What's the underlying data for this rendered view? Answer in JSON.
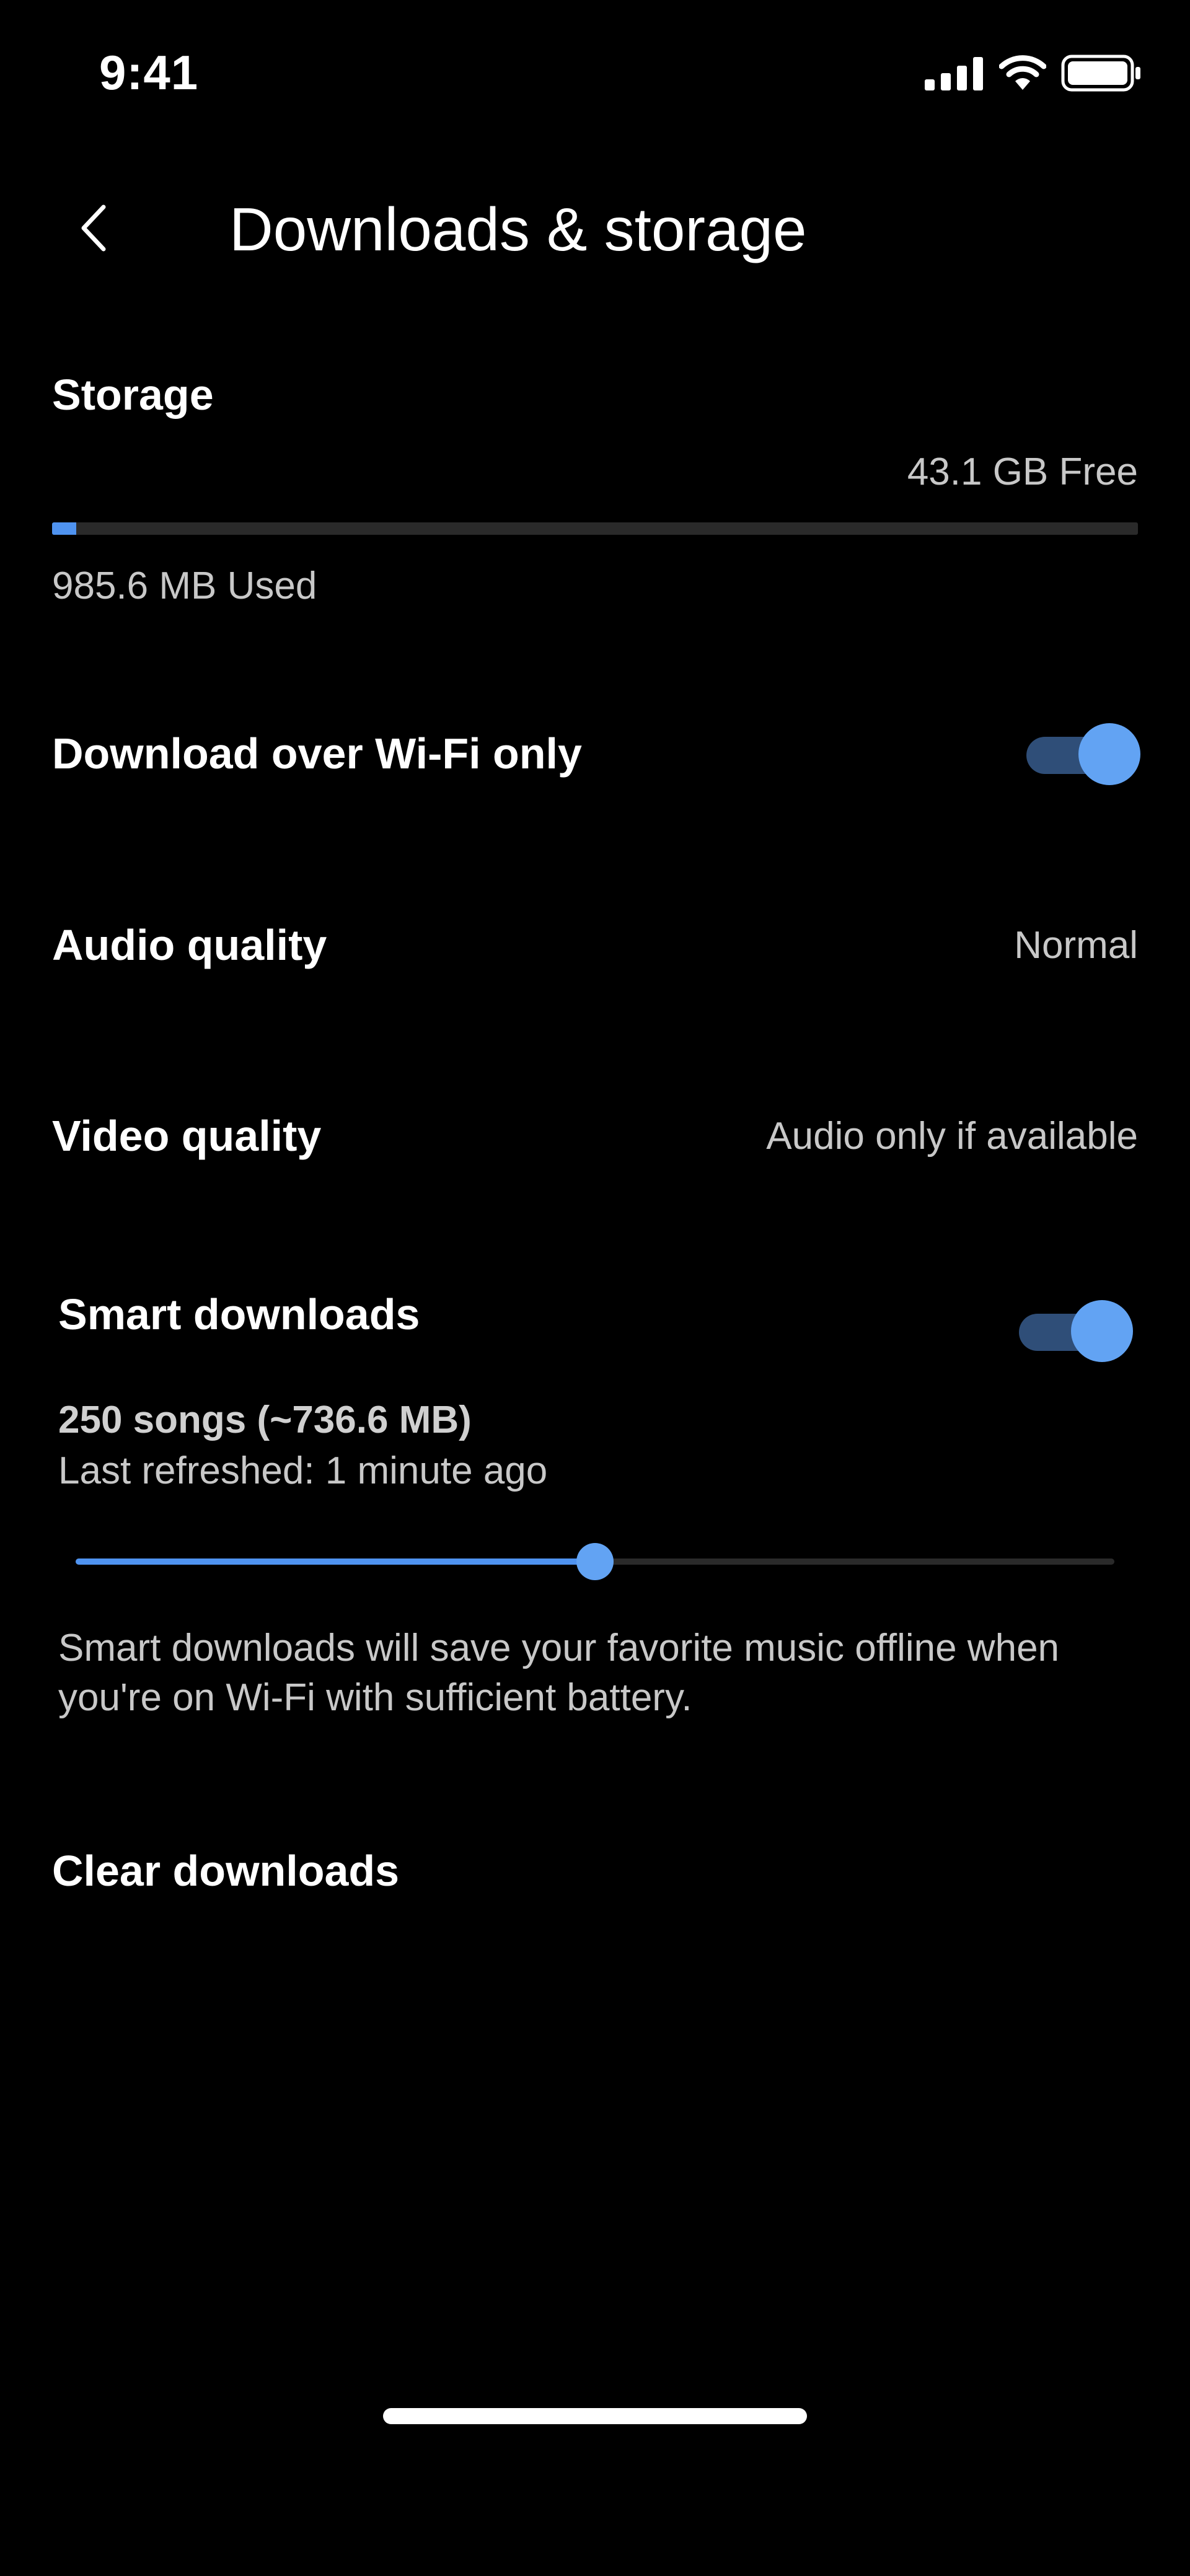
{
  "status_bar": {
    "time": "9:41",
    "icons": [
      "cellular-signal-icon",
      "wifi-icon",
      "battery-icon"
    ]
  },
  "header": {
    "back_icon": "chevron-left-icon",
    "title": "Downloads & storage"
  },
  "storage": {
    "title": "Storage",
    "free_label": "43.1 GB Free",
    "used_label": "985.6 MB Used",
    "used_fraction": 0.022
  },
  "settings": {
    "wifi_only": {
      "label": "Download over Wi-Fi only",
      "enabled": true
    },
    "audio_quality": {
      "label": "Audio quality",
      "value": "Normal"
    },
    "video_quality": {
      "label": "Video quality",
      "value": "Audio only if available"
    }
  },
  "smart_downloads": {
    "title": "Smart downloads",
    "enabled": true,
    "songs_label": "250 songs (~736.6 MB)",
    "refreshed_label": "Last refreshed: 1 minute ago",
    "slider_fraction": 0.5,
    "description": "Smart downloads will save your favorite music offline when you're on Wi-Fi with sufficient battery."
  },
  "clear_downloads": {
    "label": "Clear downloads"
  },
  "colors": {
    "background": "#000000",
    "accent": "#62a3f3",
    "toggle_track": "#2f4e78",
    "secondary_text": "#c8c8c8"
  }
}
